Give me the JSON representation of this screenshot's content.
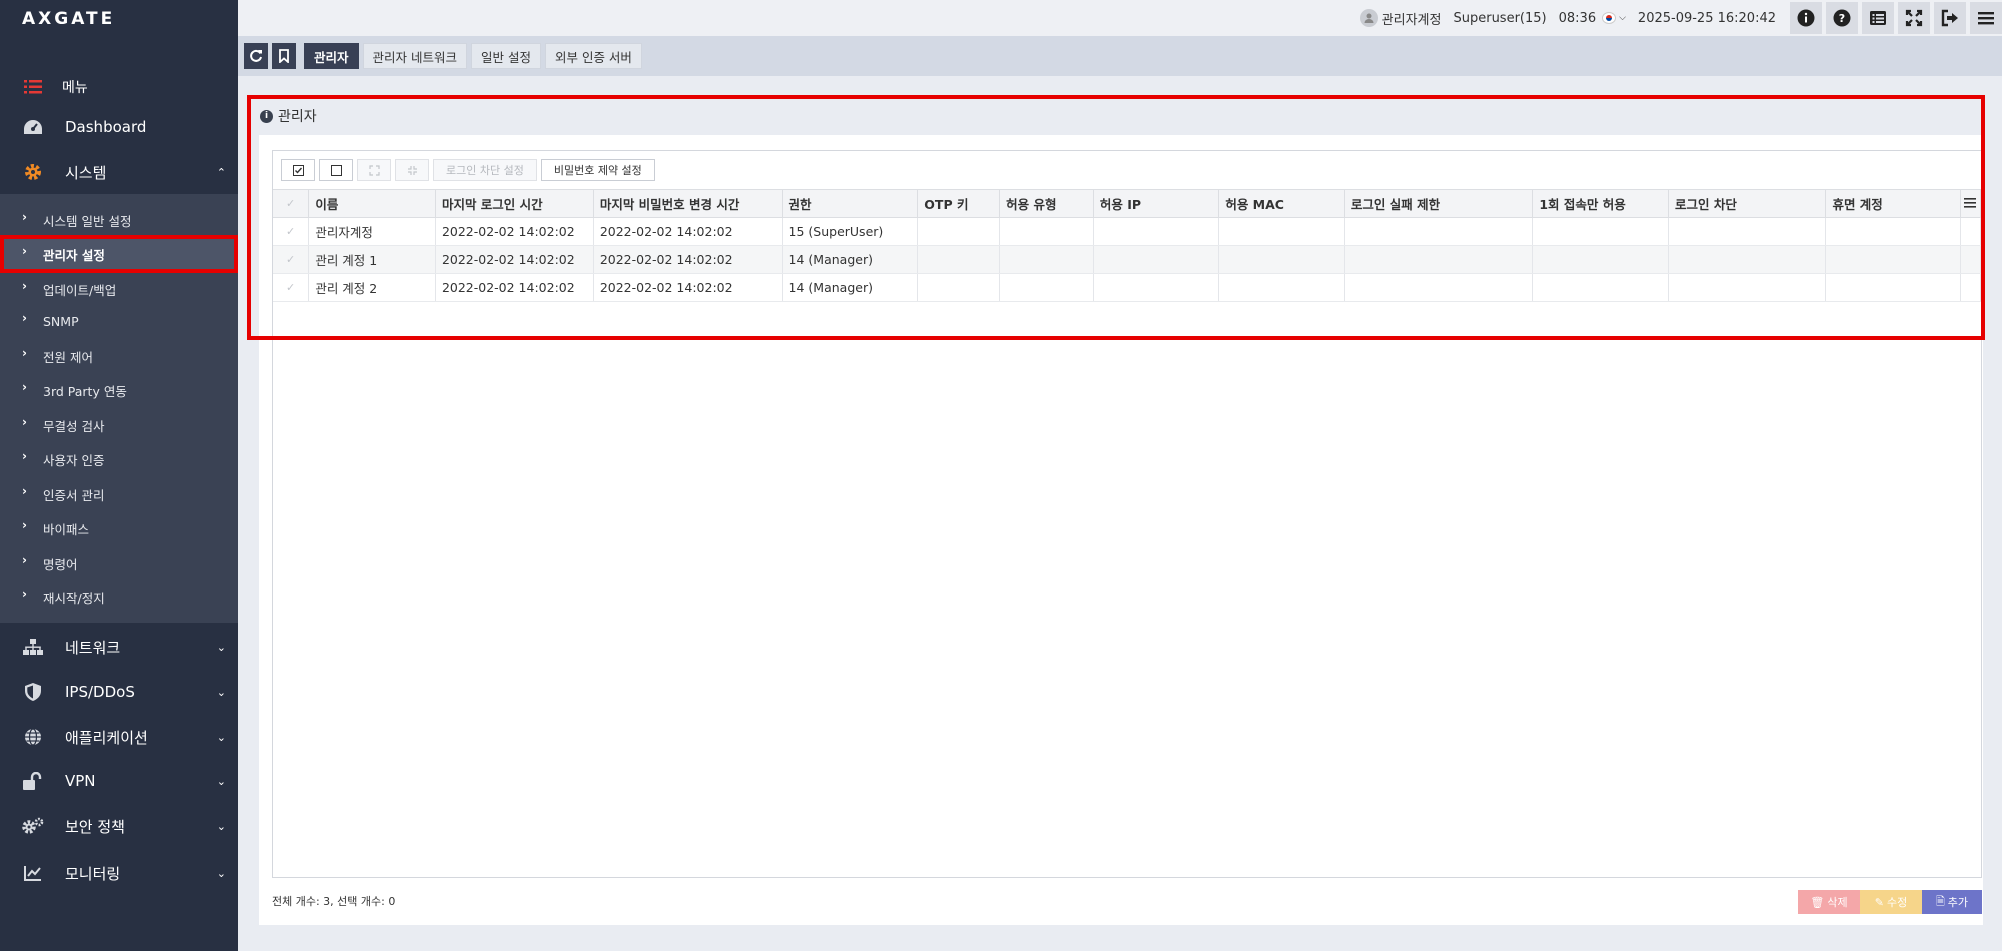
{
  "logo": "AXGATE",
  "menu": {
    "title": "메뉴",
    "dashboard": "Dashboard",
    "system": "시스템",
    "system_sub": [
      "시스템 일반 설정",
      "관리자 설정",
      "업데이트/백업",
      "SNMP",
      "전원 제어",
      "3rd Party 연동",
      "무결성 검사",
      "사용자 인증",
      "인증서 관리",
      "바이패스",
      "명령어",
      "재시작/정지"
    ],
    "network": "네트워크",
    "ips": "IPS/DDoS",
    "application": "애플리케이션",
    "vpn": "VPN",
    "security_policy": "보안 정책",
    "monitoring": "모니터링"
  },
  "topbar": {
    "account": "관리자계정",
    "role": "Superuser(15)",
    "session_time": "08:36",
    "datetime": "2025-09-25 16:20:42"
  },
  "tabs": [
    "관리자",
    "관리자 네트워크",
    "일반 설정",
    "외부 인증 서버"
  ],
  "section_title": "관리자",
  "grid_toolbar": {
    "login_block": "로그인 차단 설정",
    "password_policy": "비밀번호 제약 설정"
  },
  "table": {
    "headers": [
      "이름",
      "마지막 로그인 시간",
      "마지막 비밀번호 변경 시간",
      "권한",
      "OTP 키",
      "허용 유형",
      "허용 IP",
      "허용 MAC",
      "로그인 실패 제한",
      "1회 접속만 허용",
      "로그인 차단",
      "휴면 계정"
    ],
    "rows": [
      [
        "관리자계정",
        "2022-02-02 14:02:02",
        "2022-02-02 14:02:02",
        "15 (SuperUser)",
        "",
        "",
        "",
        "",
        "",
        "",
        "",
        ""
      ],
      [
        "관리 계정 1",
        "2022-02-02 14:02:02",
        "2022-02-02 14:02:02",
        "14 (Manager)",
        "",
        "",
        "",
        "",
        "",
        "",
        "",
        ""
      ],
      [
        "관리 계정 2",
        "2022-02-02 14:02:02",
        "2022-02-02 14:02:02",
        "14 (Manager)",
        "",
        "",
        "",
        "",
        "",
        "",
        "",
        ""
      ]
    ]
  },
  "footer": {
    "count": "전체 개수: 3, 선택 개수: 0",
    "delete": "삭제",
    "edit": "수정",
    "add": "추가"
  },
  "colors": {
    "sidebar": "#283042",
    "submenu": "#3a4254",
    "accent": "#384055",
    "highlight": "#e60000",
    "delete_btn": "#f4a7a9",
    "edit_btn": "#f6d58a",
    "add_btn": "#6d74c9"
  }
}
